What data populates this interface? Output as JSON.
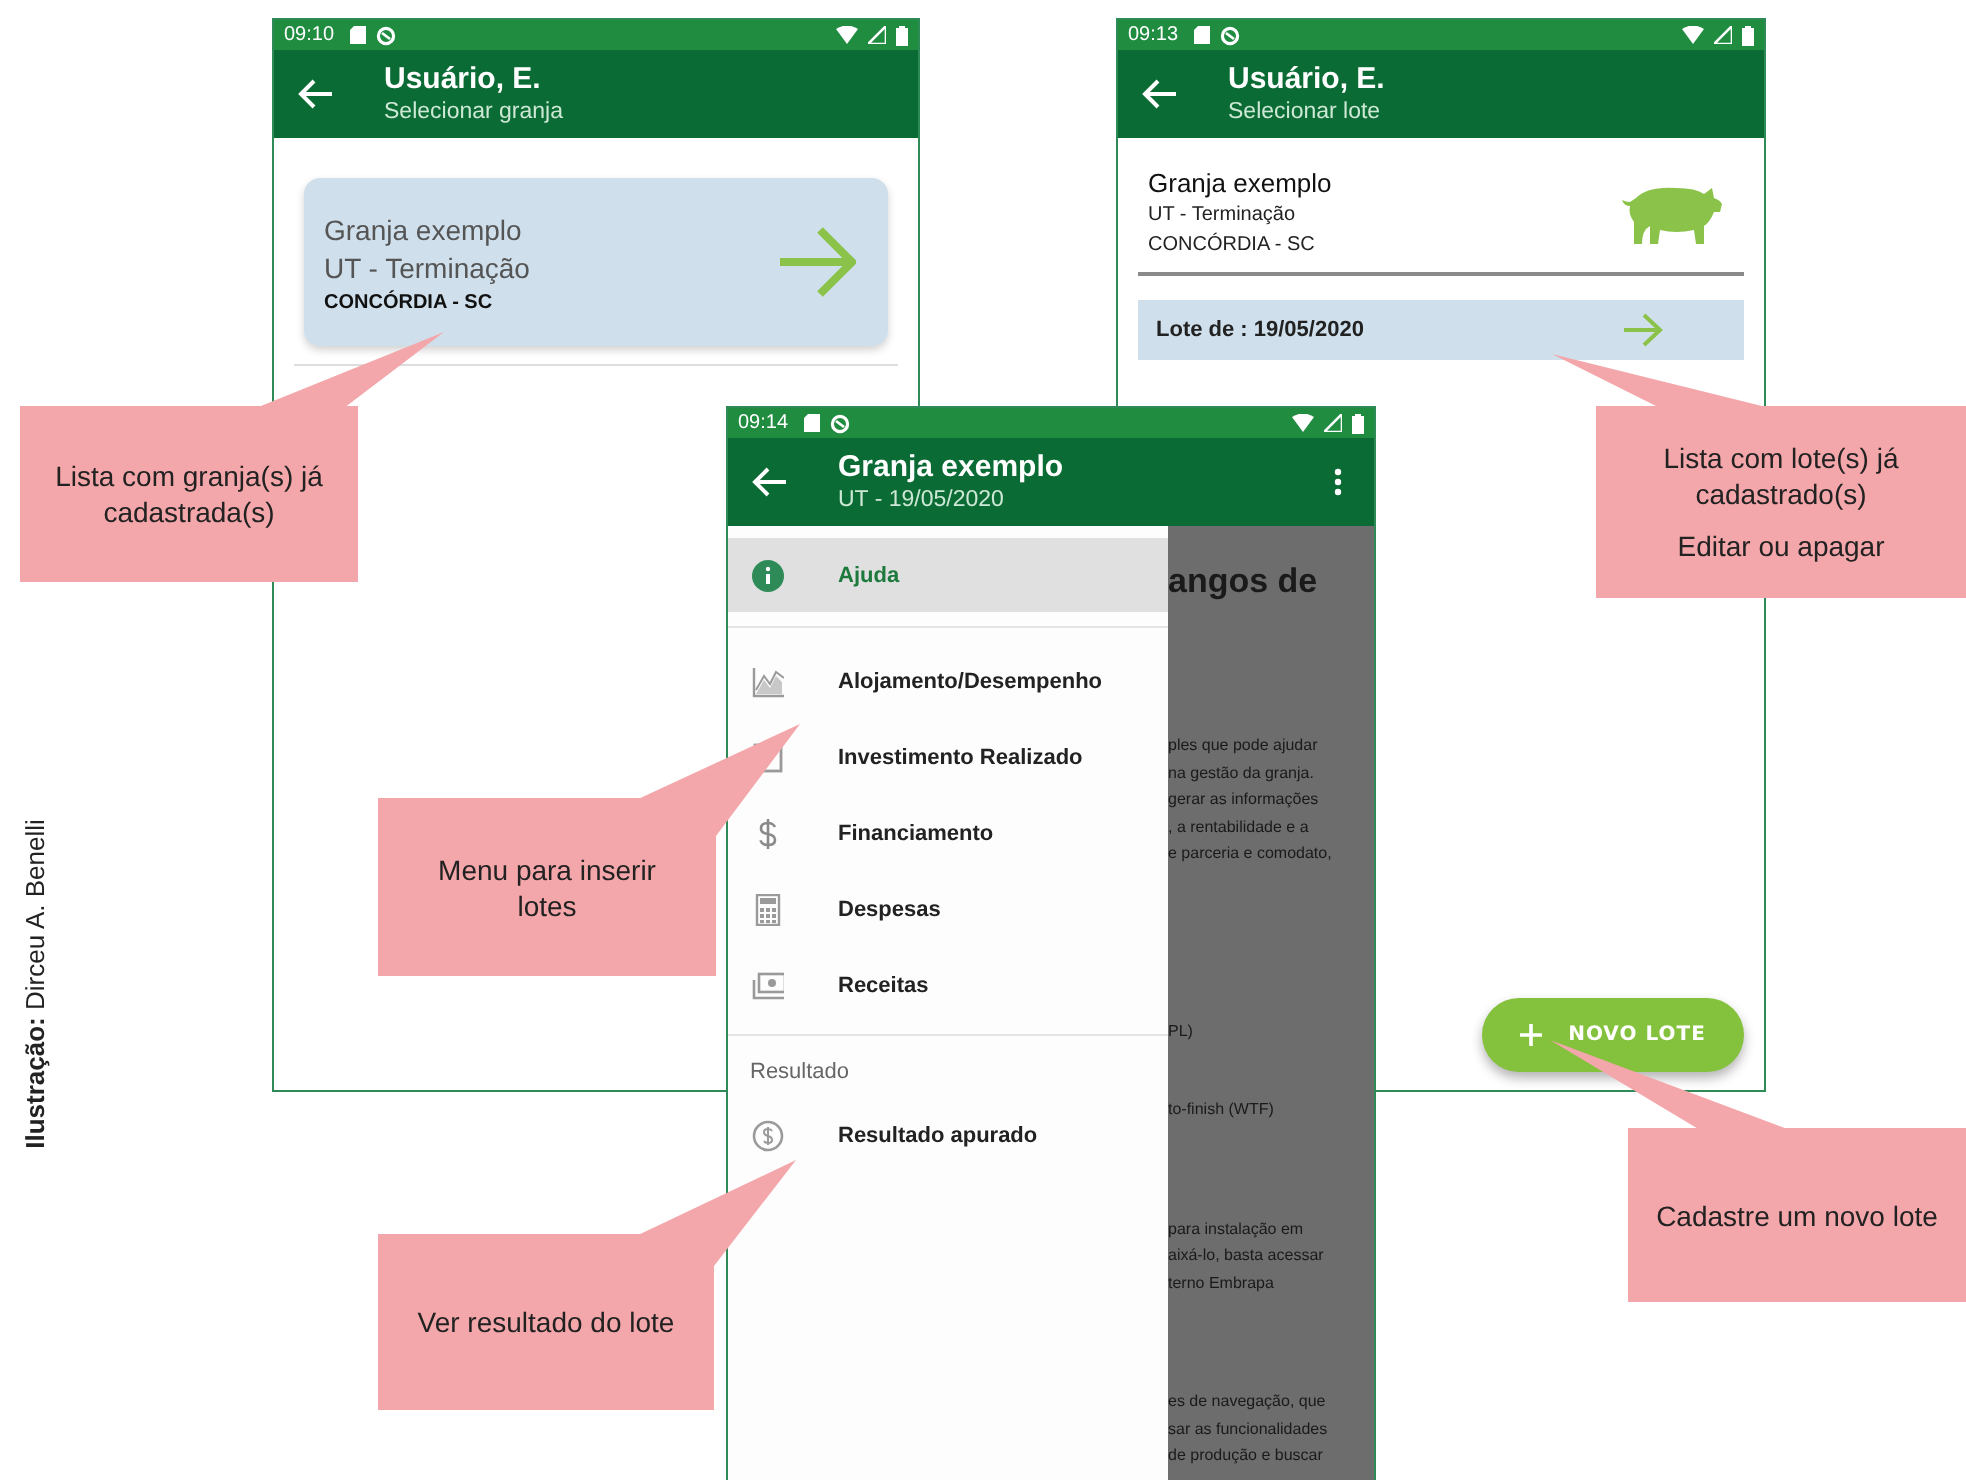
{
  "credit": "**Ilustração:** Dirceu A. Benelli",
  "screens": [
    {
      "kind": "farm_list",
      "status_time": "09:10",
      "title": "Usuário, E.",
      "subtitle": "Selecionar granja",
      "farms": [
        {
          "name": "Granja exemplo",
          "type": "UT - Terminação",
          "city": "CONCÓRDIA - SC"
        }
      ]
    },
    {
      "kind": "batch_list",
      "status_time": "09:13",
      "title": "Usuário, E.",
      "subtitle": "Selecionar lote",
      "farm": {
        "name": "Granja exemplo",
        "type": "UT - Terminação",
        "city": "CONCÓRDIA - SC"
      },
      "batches": [
        {
          "label": "Lote de : 19/05/2020"
        }
      ],
      "fab": {
        "label": "NOVO LOTE"
      }
    },
    {
      "kind": "batch_menu",
      "status_time": "09:14",
      "title": "Granja exemplo",
      "subtitle": "UT - 19/05/2020",
      "background_text": {
        "heading": "angos de",
        "blocks": [
          {
            "lines": [
              "ples que pode ajudar",
              "na gestão da granja.",
              "gerar as informações",
              ", a rentabilidade e a",
              "e parceria e comodato,"
            ]
          },
          {
            "lines": [
              "PL)"
            ]
          },
          {
            "lines": [
              "to-finish (WTF)"
            ]
          },
          {
            "lines": [
              "para instalação em",
              "aixá-lo, basta acessar",
              "terno Embrapa"
            ]
          },
          {
            "lines": [
              "es de navegação, que",
              "sar as funcionalidades",
              "de produção e buscar"
            ]
          }
        ]
      },
      "drawer": {
        "sections": [
          {
            "items": [
              {
                "label": "Ajuda",
                "selected": true
              }
            ]
          },
          {
            "items": [
              {
                "label": "Alojamento/Desempenho",
                "selected": false
              },
              {
                "label": "Investimento Realizado",
                "selected": false
              },
              {
                "label": "Financiamento",
                "selected": false
              },
              {
                "label": "Despesas",
                "selected": false
              },
              {
                "label": "Receitas",
                "selected": false
              }
            ]
          },
          {
            "header": "Resultado",
            "items": [
              {
                "label": "Resultado apurado",
                "selected": false
              }
            ]
          }
        ]
      }
    }
  ],
  "callouts": [
    {
      "paragraphs": [
        "Lista com granja(s) já cadastrada(s)"
      ]
    },
    {
      "paragraphs": [
        "Lista com lote(s) já cadastrado(s)",
        "Editar ou apagar"
      ]
    },
    {
      "paragraphs": [
        "Menu para inserir lotes"
      ]
    },
    {
      "paragraphs": [
        "Ver resultado do lote"
      ]
    },
    {
      "paragraphs": [
        "Cadastre um novo lote"
      ]
    }
  ]
}
